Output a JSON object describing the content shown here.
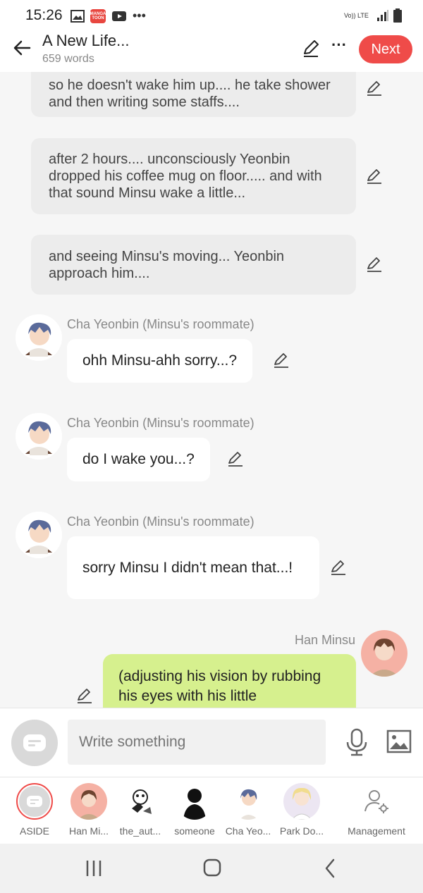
{
  "status": {
    "time": "15:26",
    "network": "Vo)) LTE"
  },
  "header": {
    "title": "A New Life...",
    "subtitle": "659 words",
    "next_label": "Next"
  },
  "narrations": [
    {
      "text": "so he doesn't wake him up.... he take shower and then writing some staffs...."
    },
    {
      "text": "after 2 hours.... unconsciously Yeonbin dropped his coffee mug on floor..... and with that sound Minsu wake a little..."
    },
    {
      "text": "and seeing Minsu's moving... Yeonbin approach him...."
    }
  ],
  "messages": [
    {
      "speaker": "Cha Yeonbin (Minsu's roommate)",
      "text": "ohh Minsu-ahh sorry...?"
    },
    {
      "speaker": "Cha Yeonbin (Minsu's roommate)",
      "text": "do I wake you...?"
    },
    {
      "speaker": "Cha Yeonbin (Minsu's roommate)",
      "text": "sorry Minsu I didn't mean that...!"
    }
  ],
  "my_message": {
    "speaker": "Han Minsu",
    "text": "(adjusting his vision by rubbing his eyes with his little"
  },
  "composer": {
    "placeholder": "Write something"
  },
  "characters": [
    {
      "label": "ASIDE"
    },
    {
      "label": "Han Mi..."
    },
    {
      "label": "the_aut..."
    },
    {
      "label": "someone"
    },
    {
      "label": "Cha Yeo..."
    },
    {
      "label": "Park Do..."
    },
    {
      "label": "Management"
    }
  ],
  "colors": {
    "accent": "#ef4b49",
    "my_bubble": "#d6f08e",
    "narration_bg": "#ececec"
  }
}
